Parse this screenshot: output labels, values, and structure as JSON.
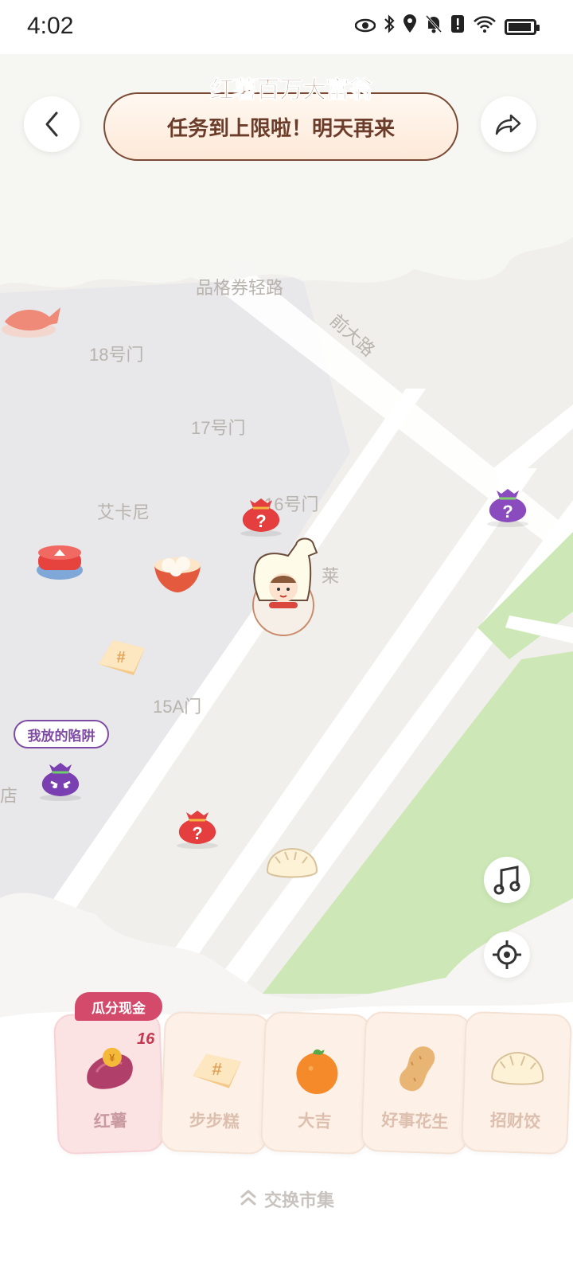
{
  "status_bar": {
    "time": "4:02",
    "icons": [
      "eye-icon",
      "bluetooth-icon",
      "location-icon",
      "bell-off-icon",
      "alert-icon",
      "wifi-icon",
      "battery-icon"
    ]
  },
  "header": {
    "logo_text": "红薯百万大富翁",
    "banner_text": "任务到上限啦！明天再来",
    "back_icon": "chevron-left-icon",
    "share_icon": "share-arrow-icon"
  },
  "map": {
    "labels": {
      "road_top": "品格券轻路",
      "road_diag": "前大路",
      "gate_18": "18号门",
      "gate_17": "17号门",
      "gate_16": "16号门",
      "store_aikani": "艾卡尼",
      "store_lai": "莱",
      "gate_15a": "15A门",
      "store_partial": "店"
    },
    "trap_tag": "我放的陷阱"
  },
  "side_controls": {
    "music_icon": "music-note-icon",
    "locate_icon": "crosshair-icon"
  },
  "collect_panel": {
    "badge": "瓜分现金",
    "count": "16",
    "items": [
      {
        "label": "红薯",
        "icon": "sweet-potato-icon"
      },
      {
        "label": "步步糕",
        "icon": "cake-icon"
      },
      {
        "label": "大吉",
        "icon": "tangerine-icon"
      },
      {
        "label": "好事花生",
        "icon": "peanut-icon"
      },
      {
        "label": "招财饺",
        "icon": "dumpling-icon"
      }
    ]
  },
  "footer": {
    "market_label": "交换市集"
  },
  "colors": {
    "accent": "#d44a6b",
    "banner_text": "#6b3c2a",
    "park_green": "#cde8b6"
  }
}
